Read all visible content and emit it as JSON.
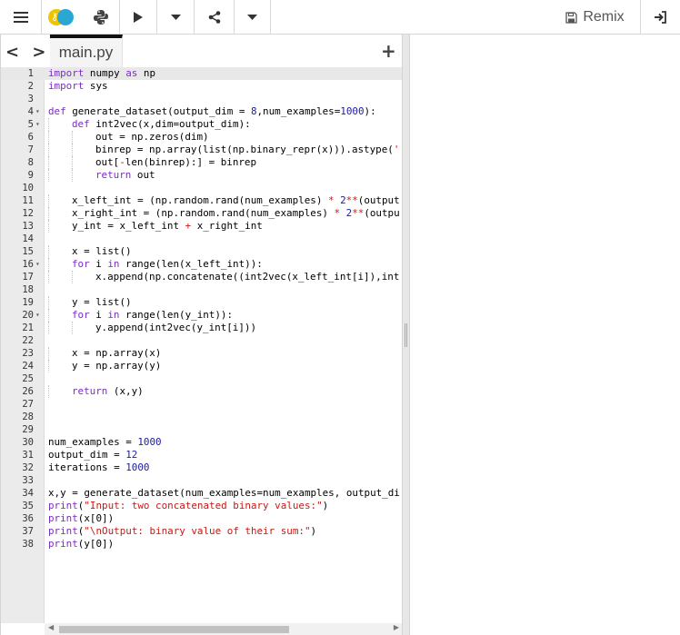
{
  "toolbar": {
    "remix_label": "Remix"
  },
  "tabs": {
    "nav_label": "< >",
    "file_name": "main.py",
    "add_label": "+"
  },
  "colors": {
    "keyword": "#7a2ec5",
    "number": "#1a1aa6",
    "string": "#c41a16"
  },
  "editor": {
    "active_line": 1,
    "lines": [
      {
        "n": "1",
        "indent": 0,
        "fold": false,
        "tokens": [
          [
            "kw",
            "import"
          ],
          [
            "t",
            " numpy "
          ],
          [
            "kw",
            "as"
          ],
          [
            "t",
            " np"
          ]
        ]
      },
      {
        "n": "2",
        "indent": 0,
        "fold": false,
        "tokens": [
          [
            "kw",
            "import"
          ],
          [
            "t",
            " sys"
          ]
        ]
      },
      {
        "n": "3",
        "indent": 0,
        "fold": false,
        "tokens": []
      },
      {
        "n": "4",
        "indent": 0,
        "fold": true,
        "tokens": [
          [
            "kw",
            "def"
          ],
          [
            "t",
            " generate_dataset(output_dim = "
          ],
          [
            "num",
            "8"
          ],
          [
            "t",
            ",num_examples="
          ],
          [
            "num",
            "1000"
          ],
          [
            "t",
            "):"
          ]
        ]
      },
      {
        "n": "5",
        "indent": 1,
        "fold": true,
        "tokens": [
          [
            "kw",
            "def"
          ],
          [
            "t",
            " int2vec(x,dim=output_dim):"
          ]
        ]
      },
      {
        "n": "6",
        "indent": 2,
        "fold": false,
        "tokens": [
          [
            "t",
            "out = np.zeros(dim)"
          ]
        ]
      },
      {
        "n": "7",
        "indent": 2,
        "fold": false,
        "tokens": [
          [
            "t",
            "binrep = np.array(list(np.binary_repr(x))).astype("
          ],
          [
            "str",
            "'"
          ]
        ]
      },
      {
        "n": "8",
        "indent": 2,
        "fold": false,
        "tokens": [
          [
            "t",
            "out["
          ],
          [
            "op",
            "-"
          ],
          [
            "t",
            "len(binrep):] = binrep"
          ]
        ]
      },
      {
        "n": "9",
        "indent": 2,
        "fold": false,
        "tokens": [
          [
            "kw",
            "return"
          ],
          [
            "t",
            " out"
          ]
        ]
      },
      {
        "n": "10",
        "indent": 0,
        "fold": false,
        "tokens": []
      },
      {
        "n": "11",
        "indent": 1,
        "fold": false,
        "tokens": [
          [
            "t",
            "x_left_int = (np.random.rand(num_examples) "
          ],
          [
            "op",
            "*"
          ],
          [
            "t",
            " "
          ],
          [
            "num",
            "2"
          ],
          [
            "op",
            "**"
          ],
          [
            "t",
            "(output"
          ]
        ]
      },
      {
        "n": "12",
        "indent": 1,
        "fold": false,
        "tokens": [
          [
            "t",
            "x_right_int = (np.random.rand(num_examples) "
          ],
          [
            "op",
            "*"
          ],
          [
            "t",
            " "
          ],
          [
            "num",
            "2"
          ],
          [
            "op",
            "**"
          ],
          [
            "t",
            "(outpu"
          ]
        ]
      },
      {
        "n": "13",
        "indent": 1,
        "fold": false,
        "tokens": [
          [
            "t",
            "y_int = x_left_int "
          ],
          [
            "op",
            "+"
          ],
          [
            "t",
            " x_right_int"
          ]
        ]
      },
      {
        "n": "14",
        "indent": 0,
        "fold": false,
        "tokens": []
      },
      {
        "n": "15",
        "indent": 1,
        "fold": false,
        "tokens": [
          [
            "t",
            "x = list()"
          ]
        ]
      },
      {
        "n": "16",
        "indent": 1,
        "fold": true,
        "tokens": [
          [
            "kw",
            "for"
          ],
          [
            "t",
            " i "
          ],
          [
            "kw",
            "in"
          ],
          [
            "t",
            " range(len(x_left_int)):"
          ]
        ]
      },
      {
        "n": "17",
        "indent": 2,
        "fold": false,
        "tokens": [
          [
            "t",
            "x.append(np.concatenate((int2vec(x_left_int[i]),int"
          ]
        ]
      },
      {
        "n": "18",
        "indent": 0,
        "fold": false,
        "tokens": []
      },
      {
        "n": "19",
        "indent": 1,
        "fold": false,
        "tokens": [
          [
            "t",
            "y = list()"
          ]
        ]
      },
      {
        "n": "20",
        "indent": 1,
        "fold": true,
        "tokens": [
          [
            "kw",
            "for"
          ],
          [
            "t",
            " i "
          ],
          [
            "kw",
            "in"
          ],
          [
            "t",
            " range(len(y_int)):"
          ]
        ]
      },
      {
        "n": "21",
        "indent": 2,
        "fold": false,
        "tokens": [
          [
            "t",
            "y.append(int2vec(y_int[i]))"
          ]
        ]
      },
      {
        "n": "22",
        "indent": 0,
        "fold": false,
        "tokens": []
      },
      {
        "n": "23",
        "indent": 1,
        "fold": false,
        "tokens": [
          [
            "t",
            "x = np.array(x)"
          ]
        ]
      },
      {
        "n": "24",
        "indent": 1,
        "fold": false,
        "tokens": [
          [
            "t",
            "y = np.array(y)"
          ]
        ]
      },
      {
        "n": "25",
        "indent": 0,
        "fold": false,
        "tokens": []
      },
      {
        "n": "26",
        "indent": 1,
        "fold": false,
        "tokens": [
          [
            "kw",
            "return"
          ],
          [
            "t",
            " (x,y)"
          ]
        ]
      },
      {
        "n": "27",
        "indent": 0,
        "fold": false,
        "tokens": []
      },
      {
        "n": "28",
        "indent": 0,
        "fold": false,
        "tokens": []
      },
      {
        "n": "29",
        "indent": 0,
        "fold": false,
        "tokens": []
      },
      {
        "n": "30",
        "indent": 0,
        "fold": false,
        "tokens": [
          [
            "t",
            "num_examples = "
          ],
          [
            "num",
            "1000"
          ]
        ]
      },
      {
        "n": "31",
        "indent": 0,
        "fold": false,
        "tokens": [
          [
            "t",
            "output_dim = "
          ],
          [
            "num",
            "12"
          ]
        ]
      },
      {
        "n": "32",
        "indent": 0,
        "fold": false,
        "tokens": [
          [
            "t",
            "iterations = "
          ],
          [
            "num",
            "1000"
          ]
        ]
      },
      {
        "n": "33",
        "indent": 0,
        "fold": false,
        "tokens": []
      },
      {
        "n": "34",
        "indent": 0,
        "fold": false,
        "tokens": [
          [
            "t",
            "x,y = generate_dataset(num_examples=num_examples, output_di"
          ]
        ]
      },
      {
        "n": "35",
        "indent": 0,
        "fold": false,
        "tokens": [
          [
            "kw",
            "print"
          ],
          [
            "t",
            "("
          ],
          [
            "str",
            "\"Input: two concatenated binary values:\""
          ],
          [
            "t",
            ")"
          ]
        ]
      },
      {
        "n": "36",
        "indent": 0,
        "fold": false,
        "tokens": [
          [
            "kw",
            "print"
          ],
          [
            "t",
            "(x[0])"
          ]
        ]
      },
      {
        "n": "37",
        "indent": 0,
        "fold": false,
        "tokens": [
          [
            "kw",
            "print"
          ],
          [
            "t",
            "("
          ],
          [
            "str",
            "\"\\nOutput: binary value of their sum:\""
          ],
          [
            "t",
            ")"
          ]
        ]
      },
      {
        "n": "38",
        "indent": 0,
        "fold": false,
        "tokens": [
          [
            "kw",
            "print"
          ],
          [
            "t",
            "(y[0])"
          ]
        ]
      }
    ]
  }
}
